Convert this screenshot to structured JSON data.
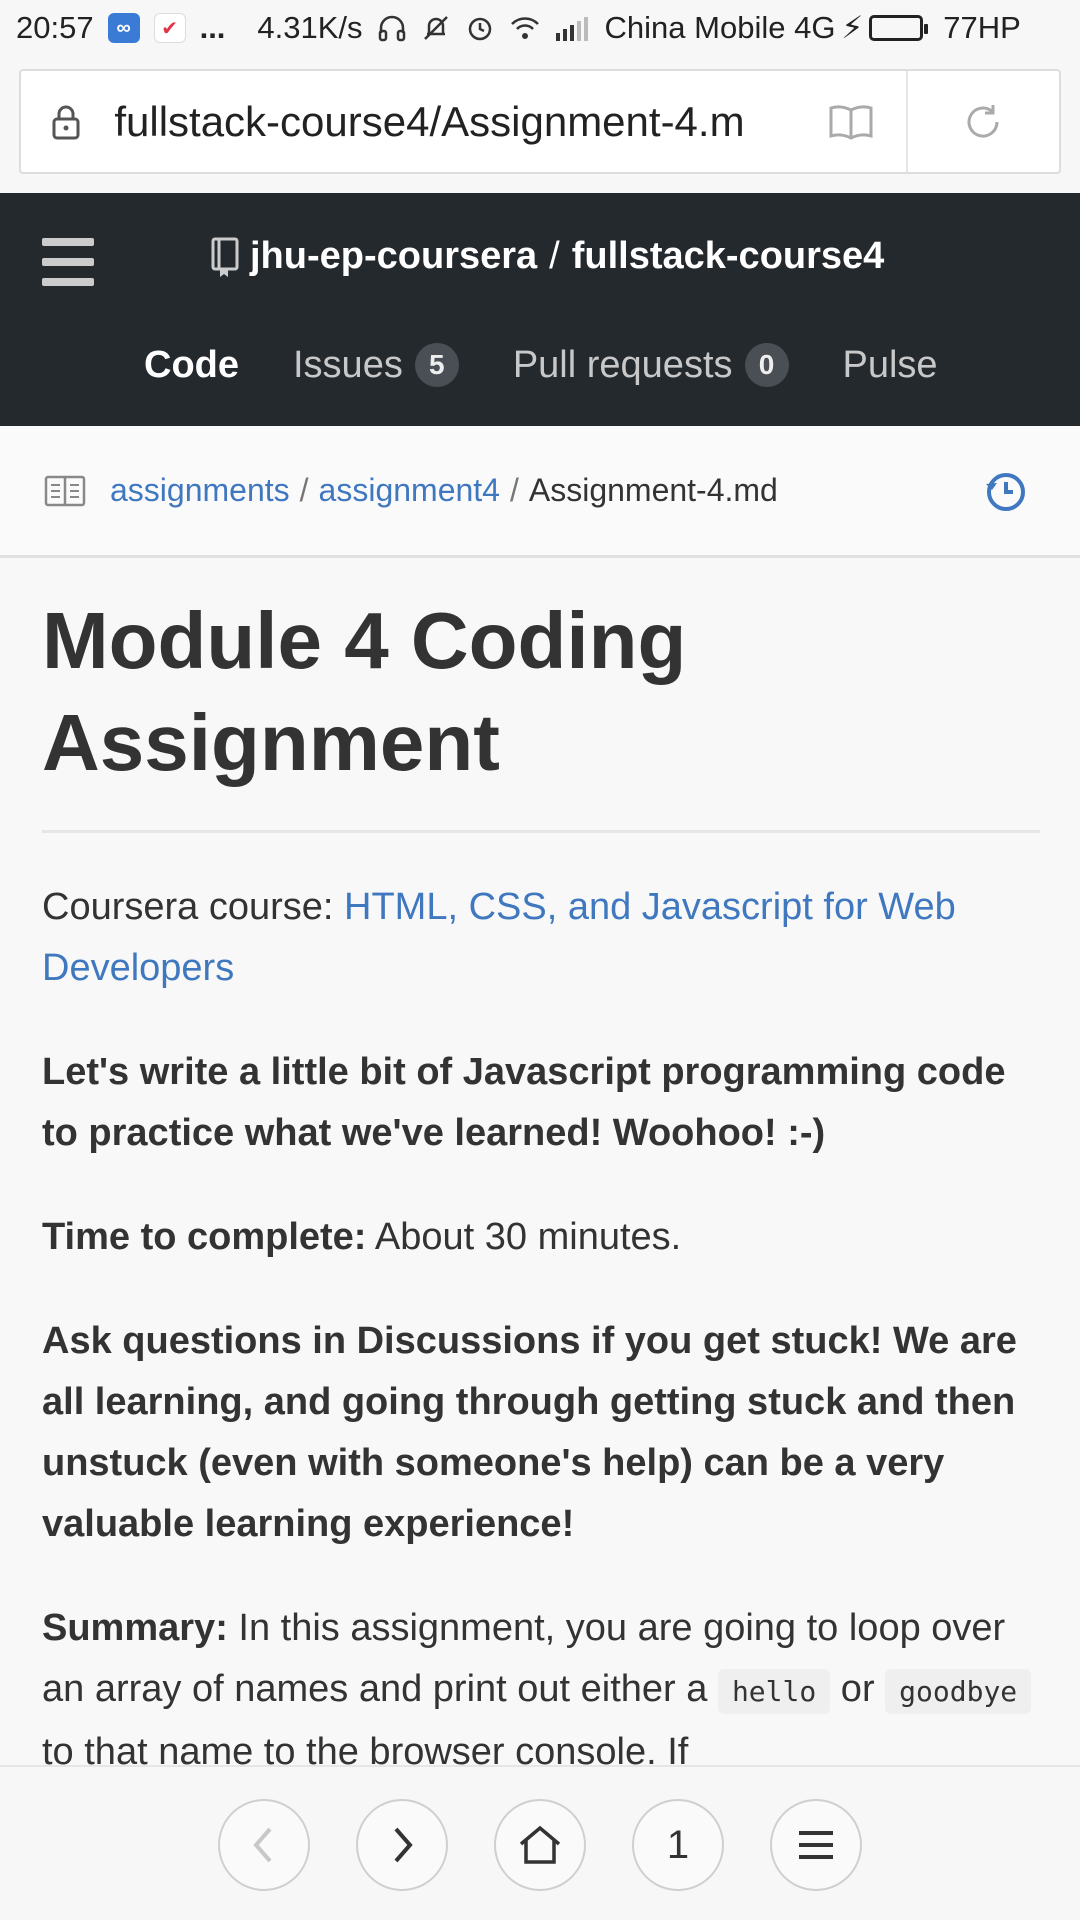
{
  "status_bar": {
    "time": "20:57",
    "dots": "...",
    "speed": "4.31K/s",
    "carrier": "China Mobile 4G",
    "battery_text": "77HP",
    "battery_level": 0.77
  },
  "browser": {
    "url": "fullstack-course4/Assignment-4.m"
  },
  "github": {
    "org": "jhu-ep-coursera",
    "separator": "/",
    "repo": "fullstack-course4",
    "nav": [
      {
        "label": "Code"
      },
      {
        "label": "Issues",
        "count": "5"
      },
      {
        "label": "Pull requests",
        "count": "0"
      },
      {
        "label": "Pulse"
      }
    ]
  },
  "breadcrumb": {
    "items": [
      "assignments",
      "assignment4"
    ],
    "separator": "/",
    "current": "Assignment-4.md"
  },
  "content": {
    "title": "Module 4 Coding Assignment",
    "course_label": "Coursera course: ",
    "course_link": "HTML, CSS, and Javascript for Web Developers",
    "intro": "Let's write a little bit of Javascript programming code to practice what we've learned! Woohoo! :-)",
    "time_label": "Time to complete:",
    "time_value": " About 30 minutes.",
    "questions": "Ask questions in Discussions if you get stuck! We are all learning, and going through getting stuck and then unstuck (even with someone's help) can be a very valuable learning experience!",
    "summary_label": "Summary:",
    "summary_part1": " In this assignment, you are going to loop over an array of names and print out either a ",
    "code_hello": "hello",
    "summary_part2": " or ",
    "code_goodbye": "goodbye",
    "summary_part3": " to that name to the browser console. If"
  },
  "bottom_nav": {
    "tab_count": "1"
  },
  "icons": {
    "back": "back-arrow-icon",
    "forward": "forward-arrow-icon",
    "home": "home-icon",
    "menu": "menu-icon"
  }
}
